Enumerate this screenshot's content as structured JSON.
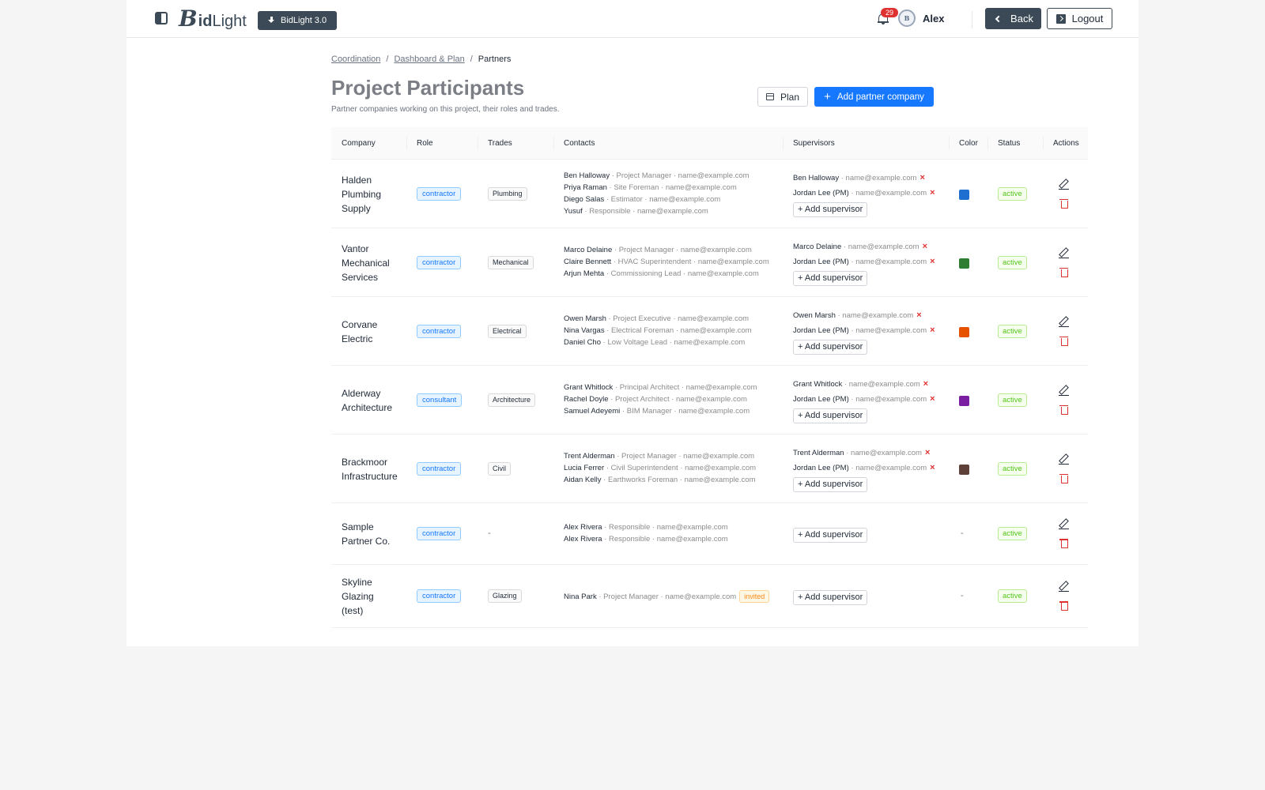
{
  "header": {
    "logo_b": "B",
    "logo_t1": "id",
    "logo_t2": "Light",
    "version_button": "BidLight 3.0",
    "notification_count": "29",
    "avatar_text": "B",
    "username": "Alex",
    "back_label": "Back",
    "logout_label": "Logout"
  },
  "breadcrumb": {
    "items": [
      "Coordination",
      "Dashboard & Plan"
    ],
    "separator": "/",
    "current": "Partners"
  },
  "page": {
    "title": "Project Participants",
    "subtitle": "Partner companies working on this project, their roles and trades.",
    "plan_button": "Plan",
    "add_button": "Add partner company"
  },
  "table": {
    "headers": {
      "company": "Company",
      "role": "Role",
      "trades": "Trades",
      "contacts": "Contacts",
      "supervisors": "Supervisors",
      "color": "Color",
      "status": "Status",
      "actions": "Actions"
    },
    "add_supervisor_label": "+ Add supervisor",
    "remove_icon": "×",
    "rows": [
      {
        "company": "Halden Plumbing Supply",
        "role": "contractor",
        "trade": "Plumbing",
        "contacts": [
          {
            "name": "Ben Halloway",
            "meta": " · Project Manager · name@example.com"
          },
          {
            "name": "Priya Raman",
            "meta": " · Site Foreman · name@example.com"
          },
          {
            "name": "Diego Salas",
            "meta": " · Estimator · name@example.com"
          },
          {
            "name": "Yusuf",
            "meta": " · Responsible · name@example.com"
          }
        ],
        "supervisors": [
          {
            "name": "Ben Halloway",
            "meta": " · name@example.com"
          },
          {
            "name": "Jordan Lee (PM)",
            "meta": " · name@example.com"
          }
        ],
        "color": "#1e6fd0",
        "status": "active"
      },
      {
        "company": "Vantor Mechanical Services",
        "role": "contractor",
        "trade": "Mechanical",
        "contacts": [
          {
            "name": "Marco Delaine",
            "meta": " · Project Manager · name@example.com"
          },
          {
            "name": "Claire Bennett",
            "meta": " · HVAC Superintendent · name@example.com"
          },
          {
            "name": "Arjun Mehta",
            "meta": " · Commissioning Lead · name@example.com"
          }
        ],
        "supervisors": [
          {
            "name": "Marco Delaine",
            "meta": " · name@example.com"
          },
          {
            "name": "Jordan Lee (PM)",
            "meta": " · name@example.com"
          }
        ],
        "color": "#2e7d32",
        "status": "active"
      },
      {
        "company": "Corvane Electric",
        "role": "contractor",
        "trade": "Electrical",
        "contacts": [
          {
            "name": "Owen Marsh",
            "meta": " · Project Executive · name@example.com"
          },
          {
            "name": "Nina Vargas",
            "meta": " · Electrical Foreman · name@example.com"
          },
          {
            "name": "Daniel Cho",
            "meta": " · Low Voltage Lead · name@example.com"
          }
        ],
        "supervisors": [
          {
            "name": "Owen Marsh",
            "meta": " · name@example.com"
          },
          {
            "name": "Jordan Lee (PM)",
            "meta": " · name@example.com"
          }
        ],
        "color": "#e65100",
        "status": "active"
      },
      {
        "company": "Alderway Architecture",
        "role": "consultant",
        "trade": "Architecture",
        "contacts": [
          {
            "name": "Grant Whitlock",
            "meta": " · Principal Architect · name@example.com"
          },
          {
            "name": "Rachel Doyle",
            "meta": " · Project Architect · name@example.com"
          },
          {
            "name": "Samuel Adeyemi",
            "meta": " · BIM Manager · name@example.com"
          }
        ],
        "supervisors": [
          {
            "name": "Grant Whitlock",
            "meta": " · name@example.com"
          },
          {
            "name": "Jordan Lee (PM)",
            "meta": " · name@example.com"
          }
        ],
        "color": "#7b1fa2",
        "status": "active"
      },
      {
        "company": "Brackmoor Infrastructure",
        "role": "contractor",
        "trade": "Civil",
        "contacts": [
          {
            "name": "Trent Alderman",
            "meta": " · Project Manager · name@example.com"
          },
          {
            "name": "Lucia Ferrer",
            "meta": " · Civil Superintendent · name@example.com"
          },
          {
            "name": "Aidan Kelly",
            "meta": " · Earthworks Foreman · name@example.com"
          }
        ],
        "supervisors": [
          {
            "name": "Trent Alderman",
            "meta": " · name@example.com"
          },
          {
            "name": "Jordan Lee (PM)",
            "meta": " · name@example.com"
          }
        ],
        "color": "#5d4037",
        "status": "active"
      },
      {
        "company": "Sample Partner Co.",
        "role": "contractor",
        "trade": "-",
        "contacts": [
          {
            "name": "Alex Rivera",
            "meta": " · Responsible · name@example.com"
          },
          {
            "name": "Alex Rivera",
            "meta": " · Responsible · name@example.com"
          }
        ],
        "supervisors": [],
        "color": "-",
        "status": "active"
      },
      {
        "company": "Skyline Glazing (test)",
        "role": "contractor",
        "trade": "Glazing",
        "contacts": [
          {
            "name": "Nina Park",
            "meta": " · Project Manager · name@example.com",
            "tag": "invited"
          }
        ],
        "supervisors": [],
        "color": "-",
        "status": "active"
      }
    ]
  }
}
